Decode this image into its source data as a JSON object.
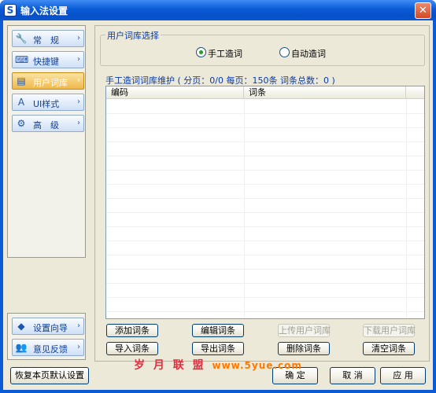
{
  "window": {
    "title": "输入法设置",
    "icon": "S",
    "close_glyph": "✕"
  },
  "sidebar": {
    "items": [
      {
        "label": "常　规",
        "icon": "wrench-icon",
        "glyph": "🔧",
        "arrow": "›",
        "selected": false
      },
      {
        "label": "快捷键",
        "icon": "keyboard-icon",
        "glyph": "⌨",
        "arrow": "›",
        "selected": false
      },
      {
        "label": "用户词库",
        "icon": "book-icon",
        "glyph": "▤",
        "arrow": "›",
        "selected": true
      },
      {
        "label": "UI样式",
        "icon": "palette-icon",
        "glyph": "A",
        "arrow": "›",
        "selected": false
      },
      {
        "label": "高　级",
        "icon": "gear-icon",
        "glyph": "⚙",
        "arrow": "›",
        "selected": false
      }
    ],
    "bottom_items": [
      {
        "label": "设置向导",
        "icon": "wizard-icon",
        "glyph": "◆",
        "arrow": "›"
      },
      {
        "label": "意见反馈",
        "icon": "feedback-icon",
        "glyph": "👥",
        "arrow": "›"
      }
    ]
  },
  "lexicon_select": {
    "title": "用户词库选择",
    "options": [
      {
        "label": "手工造词",
        "checked": true
      },
      {
        "label": "自动造词",
        "checked": false
      }
    ]
  },
  "maintenance": {
    "title": "手工造词词库维护 ( 分页：0/0   每页：150条    词条总数：0 )",
    "columns": [
      "编码",
      "词条"
    ]
  },
  "action_buttons": {
    "row1": [
      "添加词条",
      "编辑词条",
      "上传用户词库",
      "下载用户词库"
    ],
    "row2": [
      "导入词条",
      "导出词条",
      "删除词条",
      "清空词条"
    ]
  },
  "footer": {
    "reset_label": "恢复本页默认设置",
    "ok_label": "确 定",
    "cancel_label": "取 消",
    "apply_label": "应 用"
  },
  "watermark": {
    "text": "岁 月 联 盟",
    "url": "www.5yue.com"
  },
  "colors": {
    "title_bar": "#0a5ad6",
    "selected_nav": "#f0b84a",
    "group_title": "#0a3aa6",
    "watermark_red": "#e0303f"
  }
}
